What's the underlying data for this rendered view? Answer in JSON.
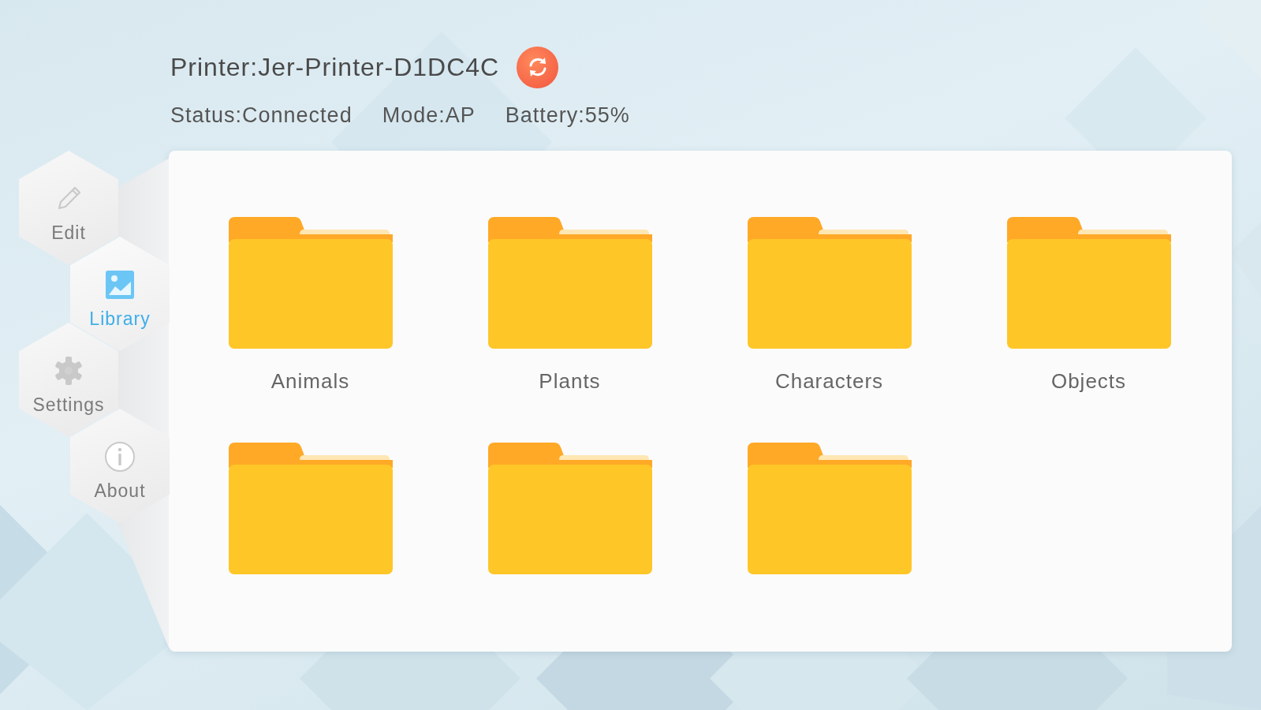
{
  "header": {
    "printer": "Printer:Jer-Printer-D1DC4C",
    "status": "Status:Connected",
    "mode": "Mode:AP",
    "battery": "Battery:55%"
  },
  "nav": [
    {
      "label": "Edit",
      "selected": false
    },
    {
      "label": "Library",
      "selected": true
    },
    {
      "label": "Settings",
      "selected": false
    },
    {
      "label": "About",
      "selected": false
    }
  ],
  "folders": [
    {
      "kind": "folder",
      "label": "Animals"
    },
    {
      "kind": "folder",
      "label": "Plants"
    },
    {
      "kind": "folder",
      "label": "Characters"
    },
    {
      "kind": "folder",
      "label": "Objects"
    },
    {
      "kind": "folder"
    },
    {
      "kind": "folder"
    },
    {
      "kind": "folder"
    }
  ]
}
